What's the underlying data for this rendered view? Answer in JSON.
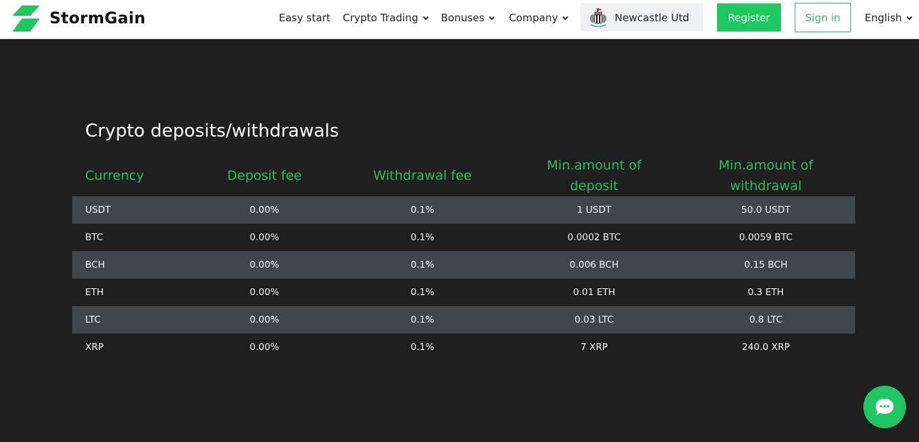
{
  "header": {
    "brand": "StormGain",
    "nav": [
      {
        "label": "Easy start",
        "has_dropdown": false
      },
      {
        "label": "Crypto Trading",
        "has_dropdown": true
      },
      {
        "label": "Bonuses",
        "has_dropdown": true
      },
      {
        "label": "Company",
        "has_dropdown": true
      }
    ],
    "partner": {
      "label": "Newcastle Utd",
      "icon": "newcastle-crest-icon"
    },
    "register_label": "Register",
    "signin_label": "Sign in",
    "language": "English"
  },
  "colors": {
    "accent": "#1ec760",
    "header_text": "#25c05a",
    "background": "#1f1f1f",
    "row_alt": "#41464a"
  },
  "section": {
    "title": "Crypto deposits/withdrawals",
    "columns": [
      "Currency",
      "Deposit fee",
      "Withdrawal fee",
      "Min.amount of deposit",
      "Min.amount of withdrawal"
    ],
    "rows": [
      [
        "USDT",
        "0.00%",
        "0.1%",
        "1 USDT",
        "50.0 USDT"
      ],
      [
        "BTC",
        "0.00%",
        "0.1%",
        "0.0002 BTC",
        "0.0059 BTC"
      ],
      [
        "BCH",
        "0.00%",
        "0.1%",
        "0.006 BCH",
        "0.15 BCH"
      ],
      [
        "ETH",
        "0.00%",
        "0.1%",
        "0.01 ETH",
        "0.3 ETH"
      ],
      [
        "LTC",
        "0.00%",
        "0.1%",
        "0.03 LTC",
        "0.8 LTC"
      ],
      [
        "XRP",
        "0.00%",
        "0.1%",
        "7 XRP",
        "240.0 XRP"
      ]
    ]
  },
  "chat": {
    "icon": "chat-bubble-icon"
  }
}
